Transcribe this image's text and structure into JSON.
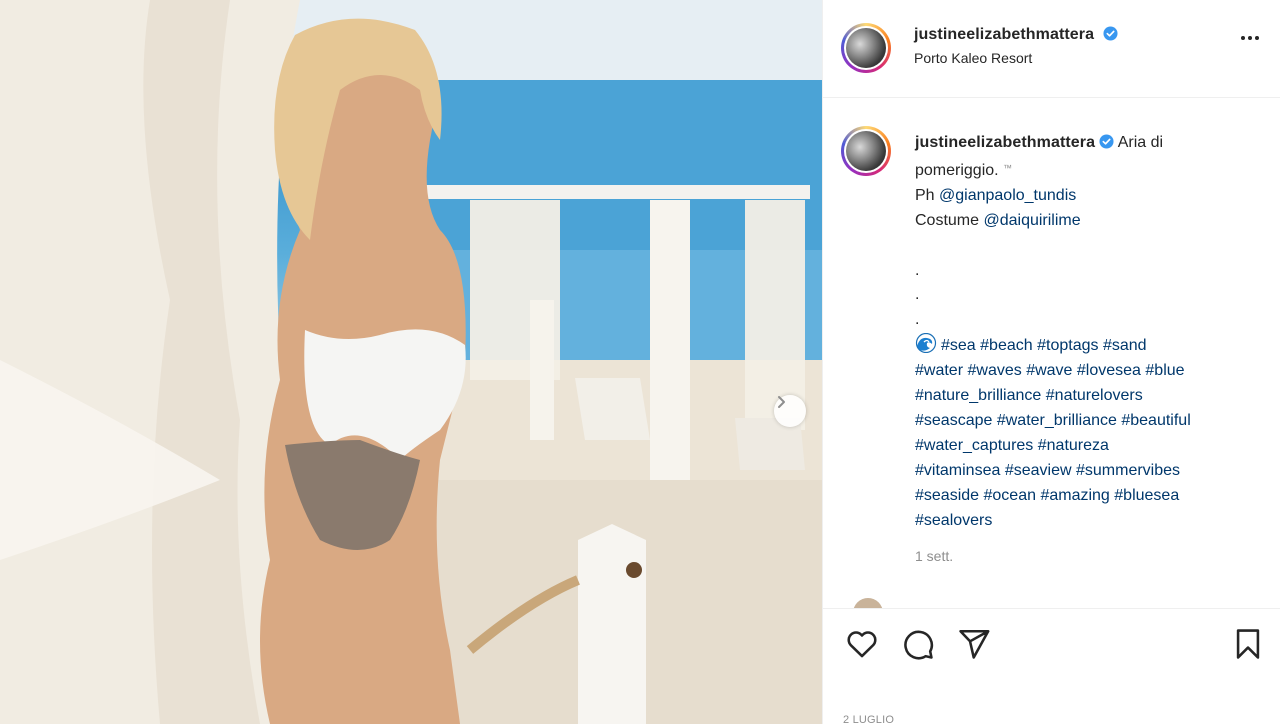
{
  "post": {
    "username": "justineelizabethmattera",
    "location": "Porto Kaleo Resort"
  },
  "caption": {
    "username": "justineelizabethmattera",
    "line1": " Aria di",
    "line2": "pomeriggio. ",
    "line2_emoji": "™",
    "line3_prefix": "Ph ",
    "photographer": "@gianpaolo_tundis",
    "line4_prefix": "Costume ",
    "costume": "@daiquirilime",
    "dots": [
      ".",
      ".",
      "."
    ],
    "hashtag_lines": [
      [
        "#sea",
        "#beach",
        "#toptags",
        "#sand"
      ],
      [
        "#water",
        "#waves",
        "#wave",
        "#lovesea",
        "#blue"
      ],
      [
        "#nature_brilliance",
        "#naturelovers"
      ],
      [
        "#seascape",
        "#water_brilliance",
        "#beautiful"
      ],
      [
        "#water_captures",
        "#natureza"
      ],
      [
        "#vitaminsea",
        "#seaview",
        "#summervibes"
      ],
      [
        "#seaside",
        "#ocean",
        "#amazing",
        "#bluesea"
      ],
      [
        "#sealovers"
      ]
    ]
  },
  "time_ago": "1 sett.",
  "date_label": "2 LUGLIO",
  "icons": {
    "more": "more-options-icon",
    "like": "heart-icon",
    "comment": "comment-icon",
    "share": "share-icon",
    "save": "bookmark-icon",
    "next": "chevron-right-icon",
    "verified": "verified-badge-icon",
    "wave": "wave-emoji-icon"
  },
  "colors": {
    "verified": "#3897f0",
    "link": "#00376b",
    "muted": "#8e8e8e"
  }
}
